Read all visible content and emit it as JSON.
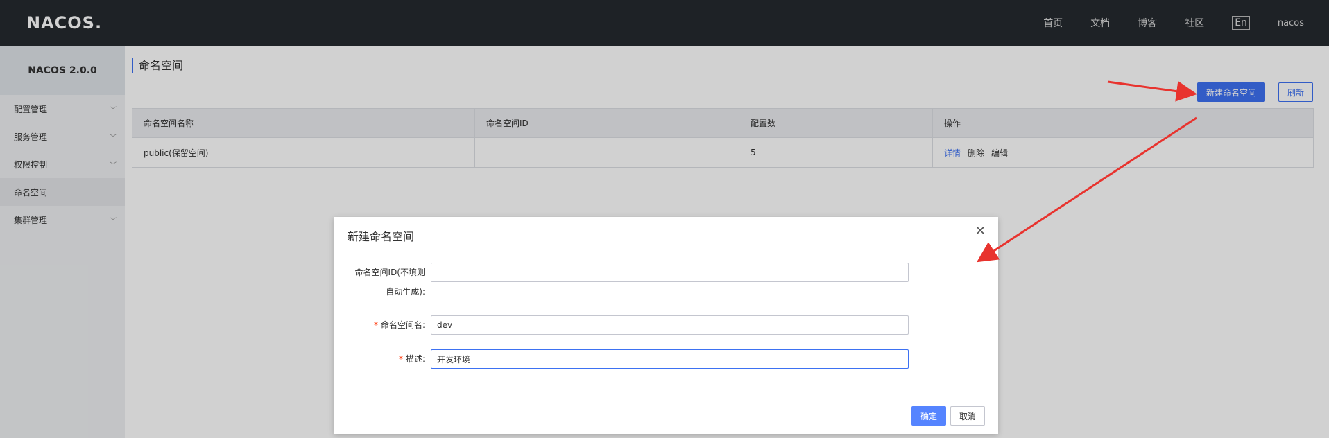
{
  "header": {
    "logo": "NACOS.",
    "nav": [
      "首页",
      "文档",
      "博客",
      "社区"
    ],
    "lang": "En",
    "user": "nacos"
  },
  "sidebar": {
    "version": "NACOS 2.0.0",
    "items": [
      {
        "label": "配置管理",
        "has_children": true
      },
      {
        "label": "服务管理",
        "has_children": true
      },
      {
        "label": "权限控制",
        "has_children": true
      },
      {
        "label": "命名空间",
        "has_children": false,
        "active": true
      },
      {
        "label": "集群管理",
        "has_children": true
      }
    ]
  },
  "main": {
    "title": "命名空间",
    "new_button": "新建命名空间",
    "refresh_button": "刷新",
    "table": {
      "columns": [
        "命名空间名称",
        "命名空间ID",
        "配置数",
        "操作"
      ],
      "rows": [
        {
          "name": "public(保留空间)",
          "id": "",
          "count": "5",
          "actions": [
            "详情",
            "删除",
            "编辑"
          ]
        }
      ]
    }
  },
  "dialog": {
    "title": "新建命名空间",
    "fields": {
      "id_label_line1": "命名空间ID(不填则",
      "id_label_line2": "自动生成):",
      "id_value": "",
      "name_label": "命名空间名:",
      "name_value": "dev",
      "desc_label": "描述:",
      "desc_value": "开发环境"
    },
    "required_mark": "*",
    "ok_button": "确定",
    "cancel_button": "取消"
  },
  "colors": {
    "primary": "#3d71f2",
    "topbar": "#252a2f",
    "annotation_arrow": "#e8332e"
  }
}
